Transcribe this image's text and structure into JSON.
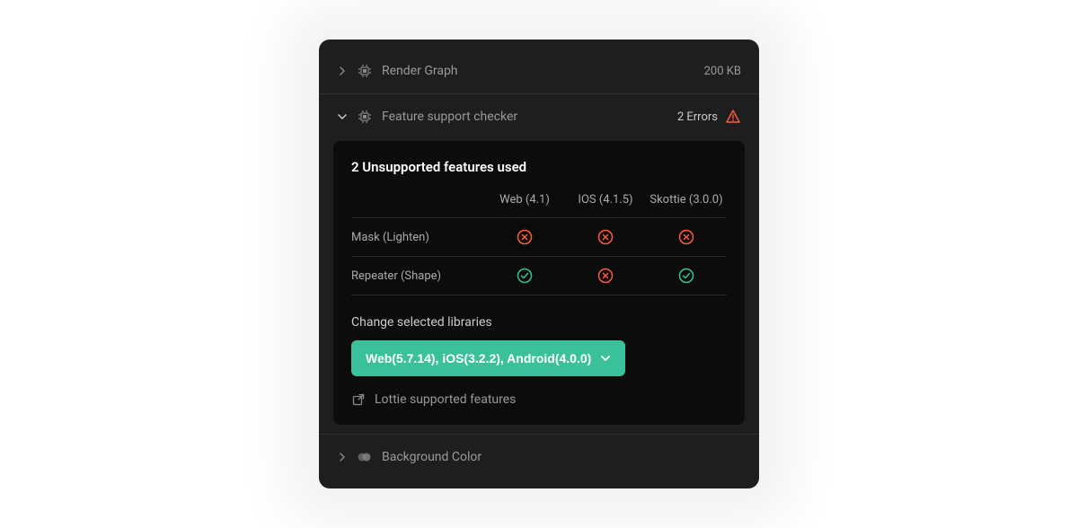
{
  "sections": {
    "render_graph": {
      "label": "Render Graph",
      "meta": "200 KB"
    },
    "feature_checker": {
      "label": "Feature support checker",
      "error_text": "2 Errors"
    },
    "background_color": {
      "label": "Background Color"
    }
  },
  "card": {
    "title": "2 Unsupported features used",
    "columns": {
      "web": "Web (4.1)",
      "ios": "IOS (4.1.5)",
      "skottie": "Skottie (3.0.0)"
    },
    "rows": {
      "mask": {
        "name": "Mask (Lighten)"
      },
      "repeater": {
        "name": "Repeater (Shape)"
      }
    },
    "change_label": "Change selected libraries",
    "dropdown_label": "Web(5.7.14), iOS(3.2.2), Android(4.0.0)",
    "link": "Lottie supported features"
  }
}
